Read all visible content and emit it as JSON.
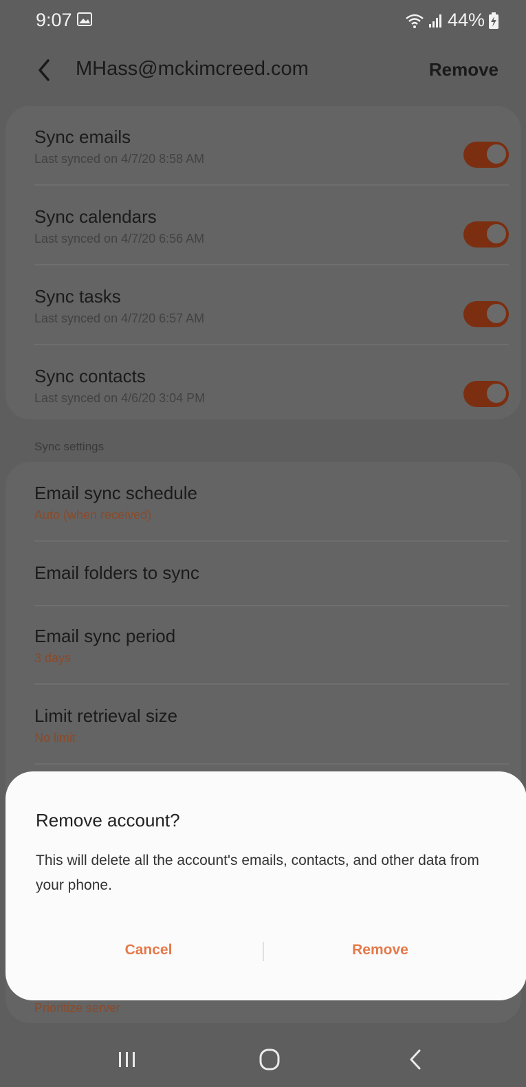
{
  "status_bar": {
    "time": "9:07",
    "battery_percent": "44%",
    "icons": [
      "gallery-icon",
      "wifi-icon",
      "signal-icon",
      "battery-charging-icon"
    ]
  },
  "app_bar": {
    "title": "MHass@mckimcreed.com",
    "action_label": "Remove",
    "back_icon": "chevron-left-icon"
  },
  "sync_items": [
    {
      "label": "Sync emails",
      "subtitle": "Last synced on 4/7/20  8:58 AM",
      "enabled": true
    },
    {
      "label": "Sync calendars",
      "subtitle": "Last synced on 4/7/20  6:56 AM",
      "enabled": true
    },
    {
      "label": "Sync tasks",
      "subtitle": "Last synced on 4/7/20  6:57 AM",
      "enabled": true
    },
    {
      "label": "Sync contacts",
      "subtitle": "Last synced on 4/6/20  3:04 PM",
      "enabled": true
    }
  ],
  "sync_settings": {
    "header": "Sync settings",
    "items": [
      {
        "label": "Email sync schedule",
        "value": "Auto (when received)"
      },
      {
        "label": "Email folders to sync",
        "value": ""
      },
      {
        "label": "Email sync period",
        "value": "3 days"
      },
      {
        "label": "Limit retrieval size",
        "value": "No limit"
      },
      {
        "label": "",
        "value": "Prioritize server"
      }
    ]
  },
  "dialog": {
    "title": "Remove account?",
    "message": "This will delete all the account's emails, contacts, and other data from your phone.",
    "cancel_label": "Cancel",
    "confirm_label": "Remove"
  },
  "nav_bar": {
    "icons": [
      "recent-apps-icon",
      "home-icon",
      "back-icon"
    ]
  },
  "colors": {
    "accent": "#e5794a",
    "scrim_background": "#5e5e5e",
    "dialog_background": "#fbfbfb"
  }
}
